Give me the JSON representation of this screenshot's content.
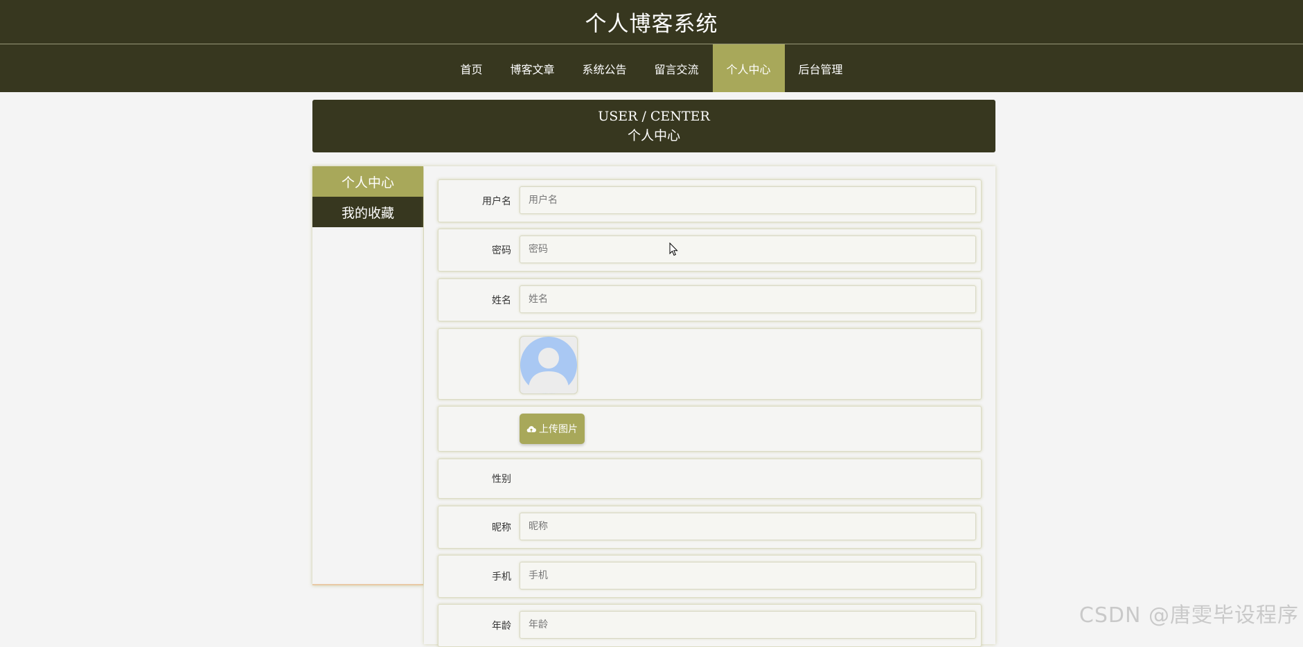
{
  "header": {
    "title": "个人博客系统"
  },
  "nav": {
    "items": [
      {
        "label": "首页"
      },
      {
        "label": "博客文章"
      },
      {
        "label": "系统公告"
      },
      {
        "label": "留言交流"
      },
      {
        "label": "个人中心",
        "active": true
      },
      {
        "label": "后台管理"
      }
    ]
  },
  "banner": {
    "en": "USER / CENTER",
    "zh": "个人中心"
  },
  "sidebar": {
    "items": [
      {
        "label": "个人中心",
        "active": true
      },
      {
        "label": "我的收藏"
      }
    ]
  },
  "form": {
    "username": {
      "label": "用户名",
      "placeholder": "用户名"
    },
    "password": {
      "label": "密码",
      "placeholder": "密码"
    },
    "name": {
      "label": "姓名",
      "placeholder": "姓名"
    },
    "upload": {
      "label": "上传图片"
    },
    "gender": {
      "label": "性别"
    },
    "nickname": {
      "label": "昵称",
      "placeholder": "昵称"
    },
    "phone": {
      "label": "手机",
      "placeholder": "手机"
    },
    "age": {
      "label": "年龄",
      "placeholder": "年龄"
    }
  },
  "watermark": "CSDN @唐雯毕设程序",
  "colors": {
    "dark": "#37371f",
    "accent": "#a8a85a",
    "avatar": "#a9c8f3"
  }
}
